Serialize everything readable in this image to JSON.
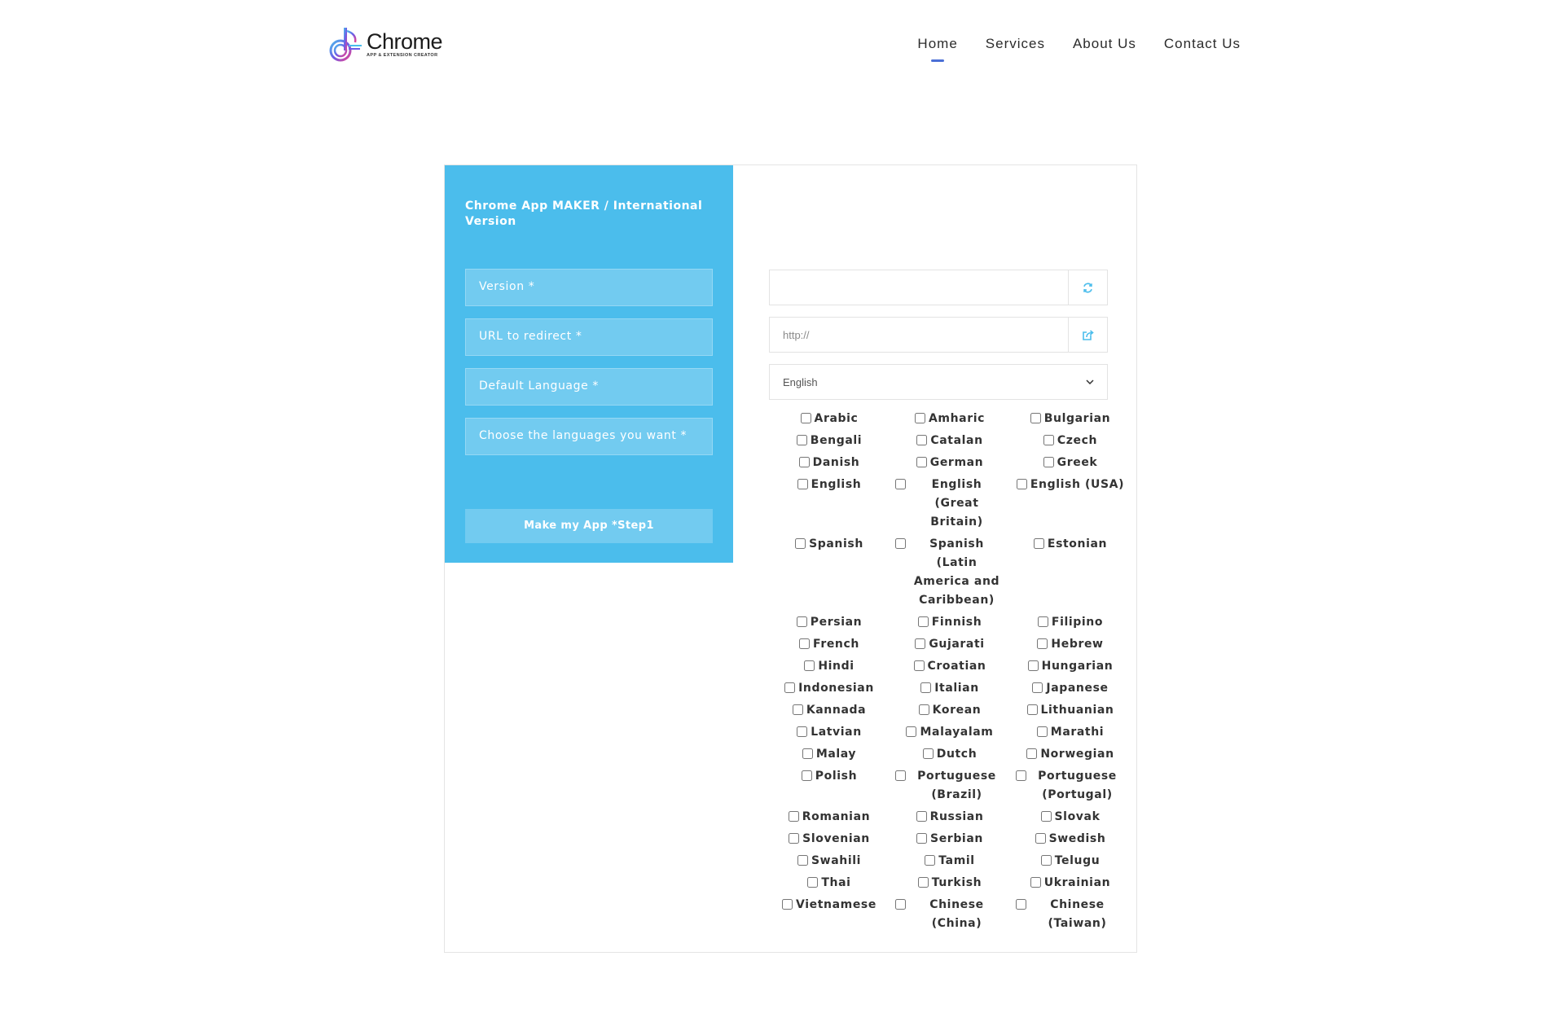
{
  "header": {
    "logo": {
      "word": "Chrome",
      "sub": "APP & EXTENSION CREATOR",
      "colors": [
        "#6c5ce7",
        "#e84393",
        "#4bbdec"
      ]
    },
    "nav": [
      {
        "label": "Home",
        "active": true
      },
      {
        "label": "Services",
        "active": false
      },
      {
        "label": "About Us",
        "active": false
      },
      {
        "label": "Contact Us",
        "active": false
      }
    ],
    "accent": "#4a6fd6"
  },
  "side": {
    "title": "Chrome App MAKER / International Version",
    "fields": [
      "Version *",
      "URL to redirect *",
      "Default Language *",
      "Choose the languages you want *"
    ],
    "button": "Make my App *Step1",
    "color": "#4bbdec"
  },
  "form": {
    "version": {
      "value": "",
      "icon": "refresh-icon"
    },
    "url": {
      "placeholder": "http://",
      "icon": "share-icon"
    },
    "language": {
      "selected": "English",
      "icon": "chevron-down-icon"
    }
  },
  "languages": [
    "Arabic",
    "Amharic",
    "Bulgarian",
    "Bengali",
    "Catalan",
    "Czech",
    "Danish",
    "German",
    "Greek",
    "English",
    "English (Great Britain)",
    "English (USA)",
    "Spanish",
    "Spanish (Latin America and Caribbean)",
    "Estonian",
    "Persian",
    "Finnish",
    "Filipino",
    "French",
    "Gujarati",
    "Hebrew",
    "Hindi",
    "Croatian",
    "Hungarian",
    "Indonesian",
    "Italian",
    "Japanese",
    "Kannada",
    "Korean",
    "Lithuanian",
    "Latvian",
    "Malayalam",
    "Marathi",
    "Malay",
    "Dutch",
    "Norwegian",
    "Polish",
    "Portuguese (Brazil)",
    "Portuguese (Portugal)",
    "Romanian",
    "Russian",
    "Slovak",
    "Slovenian",
    "Serbian",
    "Swedish",
    "Swahili",
    "Tamil",
    "Telugu",
    "Thai",
    "Turkish",
    "Ukrainian",
    "Vietnamese",
    "Chinese (China)",
    "Chinese (Taiwan)"
  ]
}
